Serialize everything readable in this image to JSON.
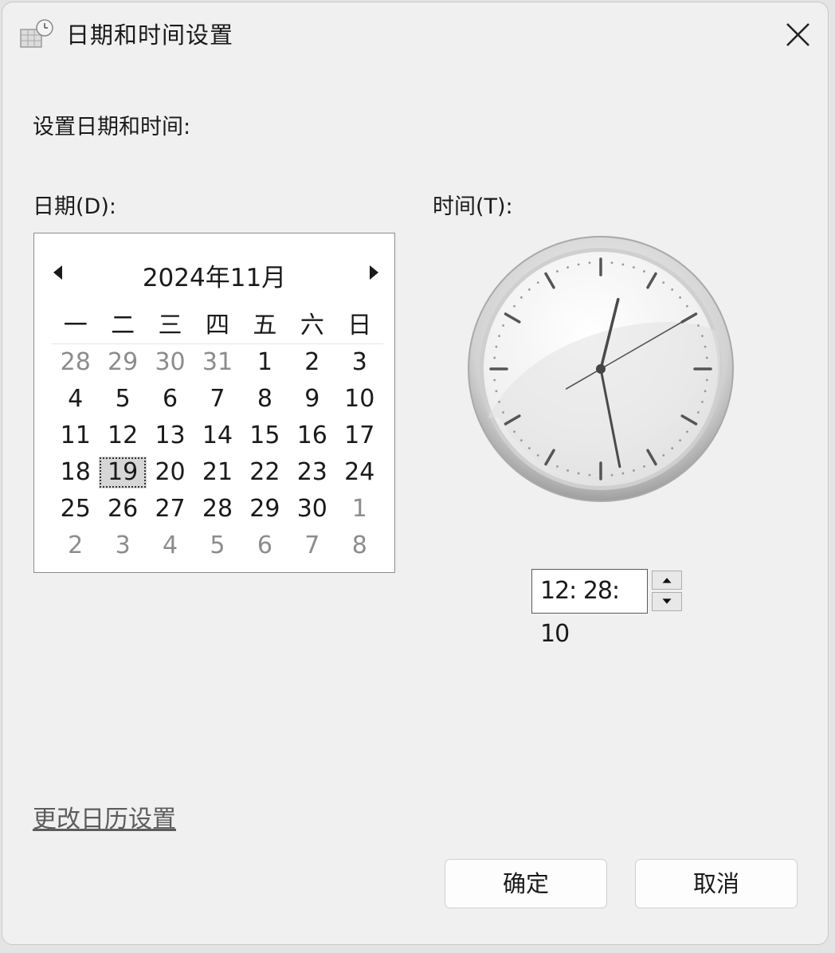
{
  "window": {
    "title": "日期和时间设置",
    "close_icon": "close-icon"
  },
  "heading": "设置日期和时间:",
  "date_label": "日期(D):",
  "time_label": "时间(T):",
  "calendar": {
    "month_title": "2024年11月",
    "weekdays": [
      "一",
      "二",
      "三",
      "四",
      "五",
      "六",
      "日"
    ],
    "weeks": [
      [
        {
          "d": "28",
          "o": true
        },
        {
          "d": "29",
          "o": true
        },
        {
          "d": "30",
          "o": true
        },
        {
          "d": "31",
          "o": true
        },
        {
          "d": "1"
        },
        {
          "d": "2"
        },
        {
          "d": "3"
        }
      ],
      [
        {
          "d": "4"
        },
        {
          "d": "5"
        },
        {
          "d": "6"
        },
        {
          "d": "7"
        },
        {
          "d": "8"
        },
        {
          "d": "9"
        },
        {
          "d": "10"
        }
      ],
      [
        {
          "d": "11"
        },
        {
          "d": "12"
        },
        {
          "d": "13"
        },
        {
          "d": "14"
        },
        {
          "d": "15"
        },
        {
          "d": "16"
        },
        {
          "d": "17"
        }
      ],
      [
        {
          "d": "18"
        },
        {
          "d": "19",
          "s": true
        },
        {
          "d": "20"
        },
        {
          "d": "21"
        },
        {
          "d": "22"
        },
        {
          "d": "23"
        },
        {
          "d": "24"
        }
      ],
      [
        {
          "d": "25"
        },
        {
          "d": "26"
        },
        {
          "d": "27"
        },
        {
          "d": "28"
        },
        {
          "d": "29"
        },
        {
          "d": "30"
        },
        {
          "d": "1",
          "o": true
        }
      ],
      [
        {
          "d": "2",
          "o": true
        },
        {
          "d": "3",
          "o": true
        },
        {
          "d": "4",
          "o": true
        },
        {
          "d": "5",
          "o": true
        },
        {
          "d": "6",
          "o": true
        },
        {
          "d": "7",
          "o": true
        },
        {
          "d": "8",
          "o": true
        }
      ]
    ]
  },
  "clock": {
    "hour": 12,
    "minute": 28,
    "second": 10
  },
  "time_value": "12: 28: 10",
  "change_calendar_link": "更改日历设置",
  "buttons": {
    "ok": "确定",
    "cancel": "取消"
  }
}
